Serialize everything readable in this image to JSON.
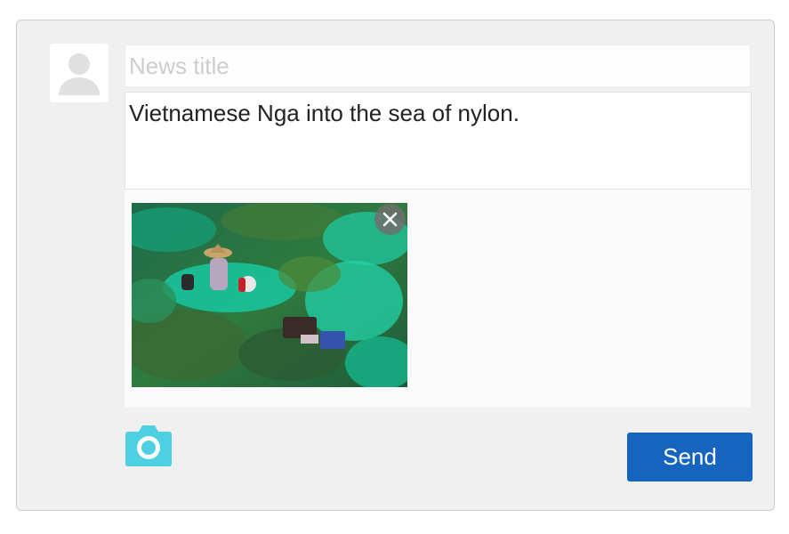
{
  "post_form": {
    "title_placeholder": "News title",
    "title_value": "",
    "content_text": "Vietnamese Nga into the sea of nylon.",
    "send_label": "Send",
    "avatar_icon": "user-placeholder-icon",
    "camera_icon": "camera-icon",
    "remove_icon": "close-icon"
  },
  "colors": {
    "background": "#f0f0f0",
    "send_button": "#1565c0",
    "camera_icon": "#4dd0e1",
    "avatar_icon": "#e0e0e0"
  }
}
